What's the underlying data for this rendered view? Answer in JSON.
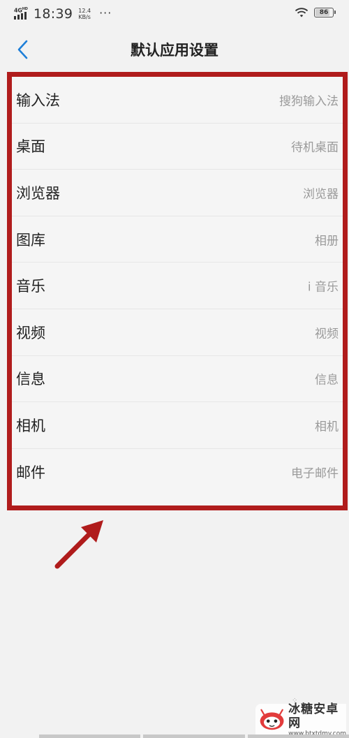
{
  "status_bar": {
    "network_type": "4G",
    "network_sub": "HD",
    "time": "18:39",
    "speed_value": "12.4",
    "speed_unit": "KB/s",
    "more_indicator": "···",
    "battery_level": "86",
    "battery_fraction": 0.86
  },
  "header": {
    "title": "默认应用设置",
    "back_icon": "chevron-left-icon",
    "accent_color": "#1e7fd8"
  },
  "default_apps": {
    "items": [
      {
        "label": "输入法",
        "value": "搜狗输入法"
      },
      {
        "label": "桌面",
        "value": "待机桌面"
      },
      {
        "label": "浏览器",
        "value": "浏览器"
      },
      {
        "label": "图库",
        "value": "相册"
      },
      {
        "label": "音乐",
        "value": "i 音乐"
      },
      {
        "label": "视频",
        "value": "视频"
      },
      {
        "label": "信息",
        "value": "信息"
      },
      {
        "label": "相机",
        "value": "相机"
      },
      {
        "label": "邮件",
        "value": "电子邮件"
      }
    ]
  },
  "annotation": {
    "highlight_color": "#b01c1c",
    "arrow_icon": "arrow-up-right-icon"
  },
  "watermark": {
    "name": "冰糖安卓网",
    "url": "www.btxtdmy.com"
  }
}
